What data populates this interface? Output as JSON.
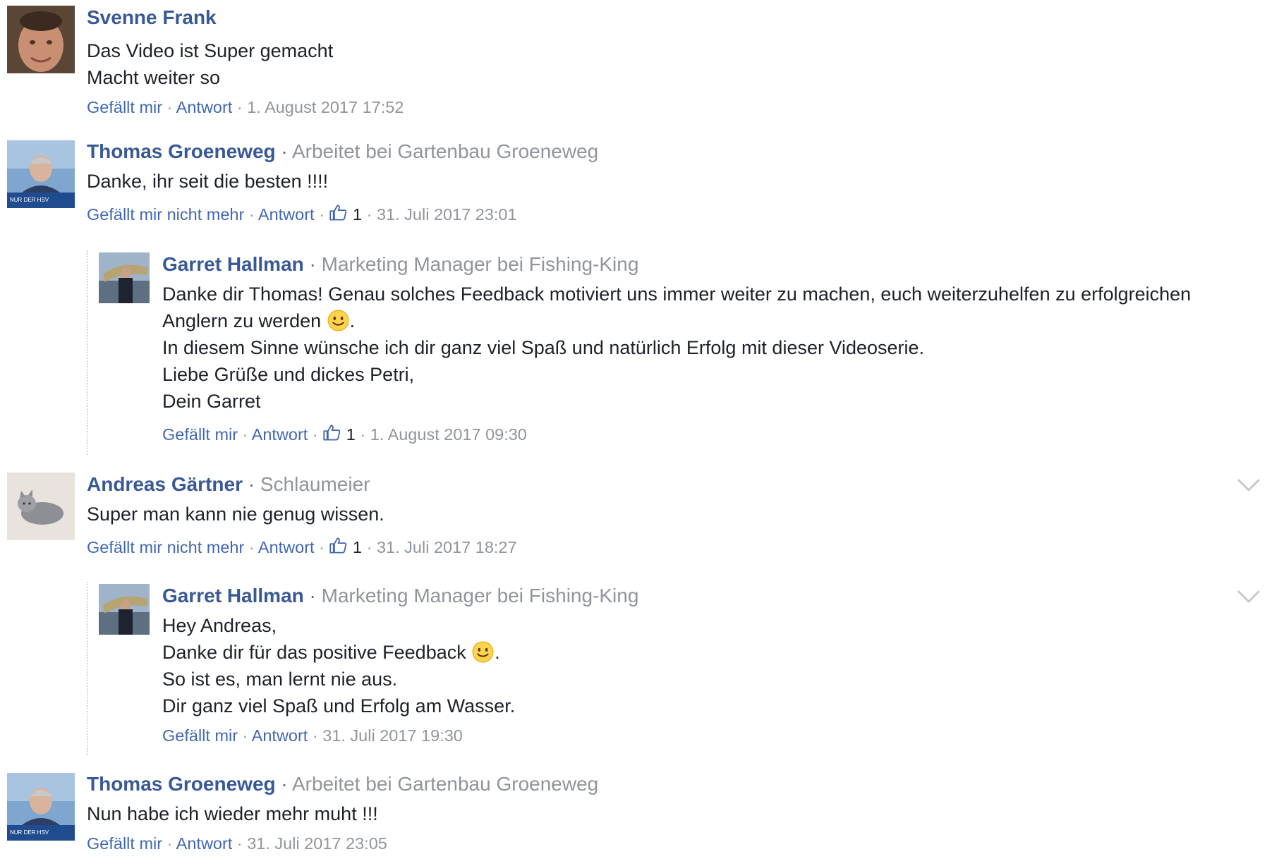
{
  "comments": [
    {
      "author": "Svenne Frank",
      "subtitle": "",
      "lines": [
        "Das Video ist Super gemacht",
        "Macht weiter so"
      ],
      "like_label": "Gefällt mir",
      "reply_label": "Antwort",
      "likes": "",
      "timestamp": "1. August 2017 17:52"
    },
    {
      "author": "Thomas Groeneweg",
      "subtitle": "Arbeitet bei Gartenbau Groeneweg",
      "lines": [
        "Danke, ihr seit die besten !!!!"
      ],
      "like_label": "Gefällt mir nicht mehr",
      "reply_label": "Antwort",
      "likes": "1",
      "timestamp": "31. Juli 2017 23:01",
      "avatar_caption": "NUR DER HSV"
    },
    {
      "author": "Garret Hallman",
      "subtitle": "Marketing Manager bei Fishing-King",
      "lines": [
        "Danke dir Thomas! Genau solches Feedback motiviert uns immer weiter zu machen, euch weiterzuhelfen zu erfolgreichen",
        "Anglern zu werden",
        "In diesem Sinne wünsche ich dir ganz viel Spaß und natürlich Erfolg mit dieser Videoserie.",
        "Liebe Grüße und dickes Petri,",
        "Dein Garret"
      ],
      "like_label": "Gefällt mir",
      "reply_label": "Antwort",
      "likes": "1",
      "timestamp": "1. August 2017 09:30"
    },
    {
      "author": "Andreas Gärtner",
      "subtitle": "Schlaumeier",
      "lines": [
        "Super man kann nie genug wissen."
      ],
      "like_label": "Gefällt mir nicht mehr",
      "reply_label": "Antwort",
      "likes": "1",
      "timestamp": "31. Juli 2017 18:27"
    },
    {
      "author": "Garret Hallman",
      "subtitle": "Marketing Manager bei Fishing-King",
      "lines": [
        "Hey Andreas,",
        "Danke dir für das positive Feedback",
        "So ist es, man lernt nie aus.",
        "Dir ganz viel Spaß und Erfolg am Wasser."
      ],
      "like_label": "Gefällt mir",
      "reply_label": "Antwort",
      "likes": "",
      "timestamp": "31. Juli 2017 19:30"
    },
    {
      "author": "Thomas Groeneweg",
      "subtitle": "Arbeitet bei Gartenbau Groeneweg",
      "lines": [
        "Nun habe ich wieder mehr muht !!!"
      ],
      "like_label": "Gefällt mir",
      "reply_label": "Antwort",
      "likes": "",
      "timestamp": "31. Juli 2017 23:05",
      "avatar_caption": "NUR DER HSV"
    }
  ],
  "separator": "·",
  "icons": {
    "like": "thumbs-up-icon",
    "emoji": "smiley-emoji-icon",
    "menu": "chevron-down-icon"
  },
  "colors": {
    "author": "#385898",
    "link": "#4267b2",
    "meta": "#90949c",
    "text": "#1d2129"
  }
}
